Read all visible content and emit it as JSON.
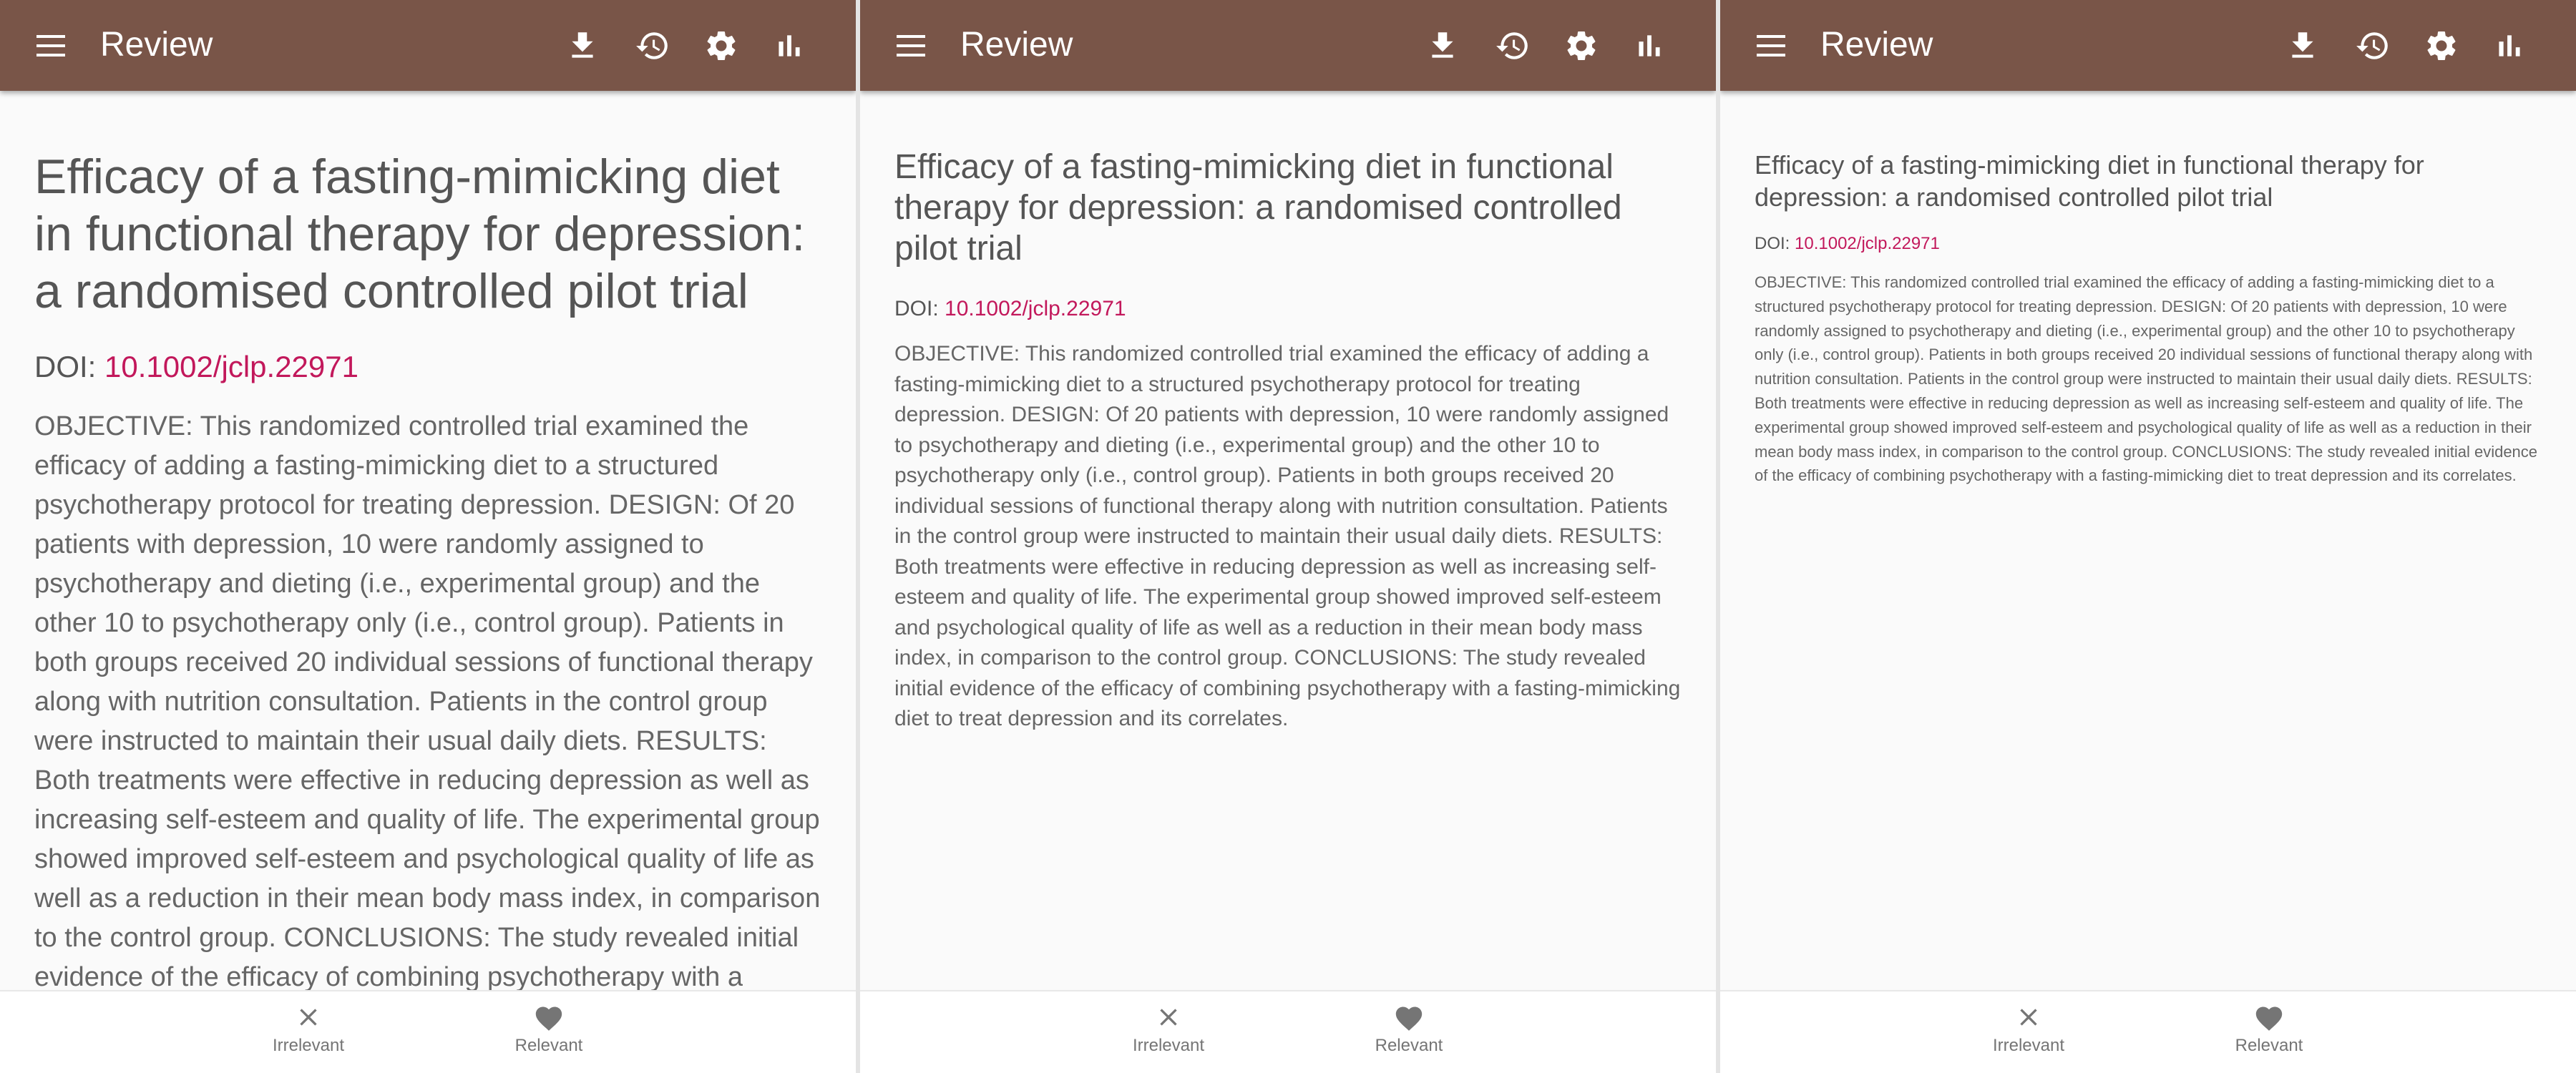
{
  "app": {
    "title": "Review"
  },
  "toolbar": {
    "menu": "menu-icon",
    "actions": [
      "download-icon",
      "history-icon",
      "settings-icon",
      "bar-chart-icon"
    ]
  },
  "article": {
    "title": "Efficacy of a fasting-mimicking diet in functional therapy for depression: a randomised controlled pilot trial",
    "doi_label": "DOI:",
    "doi": "10.1002/jclp.22971",
    "abstract": "OBJECTIVE: This randomized controlled trial examined the efficacy of adding a fasting-mimicking diet to a structured psychotherapy protocol for treating depression. DESIGN: Of 20 patients with depression, 10 were randomly assigned to psychotherapy and dieting (i.e., experimental group) and the other 10 to psychotherapy only (i.e., control group). Patients in both groups received 20 individual sessions of functional therapy along with nutrition consultation. Patients in the control group were instructed to maintain their usual daily diets. RESULTS: Both treatments were effective in reducing depression as well as increasing self-esteem and quality of life. The experimental group showed improved self-esteem and psychological quality of life as well as a reduction in their mean body mass index, in comparison to the control group. CONCLUSIONS: The study revealed initial evidence of the efficacy of combining psychotherapy with a fasting-mimicking diet to treat depression and its correlates."
  },
  "bottom_bar": {
    "irrelevant_label": "Irrelevant",
    "relevant_label": "Relevant"
  },
  "colors": {
    "appbar": "#795548",
    "link": "#c2185b",
    "background": "#fafafa",
    "icon_gray": "#757575"
  }
}
